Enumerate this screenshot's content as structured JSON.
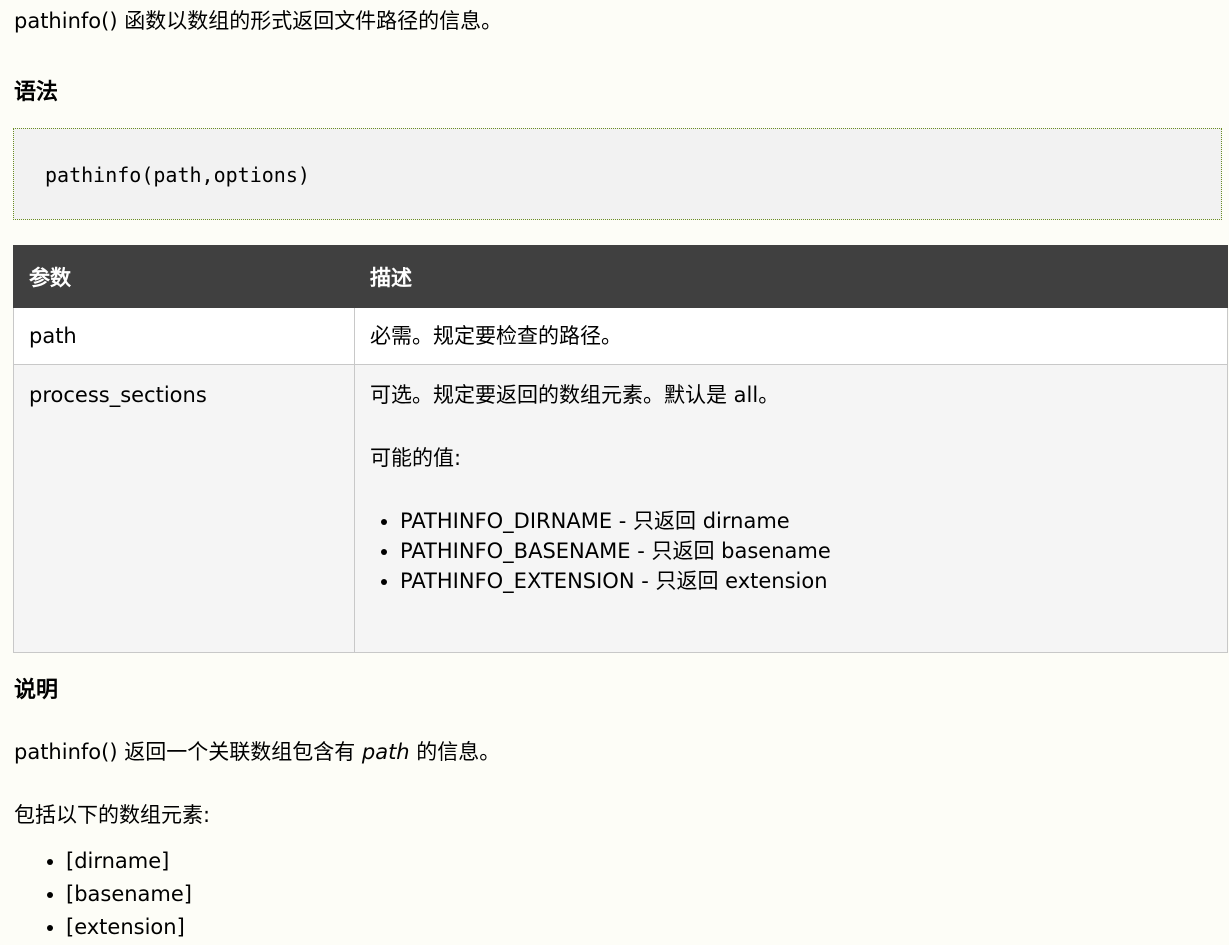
{
  "intro": "pathinfo() 函数以数组的形式返回文件路径的信息。",
  "syntax": {
    "heading": "语法",
    "code": "pathinfo(path,options)"
  },
  "params_table": {
    "headers": [
      "参数",
      "描述"
    ],
    "rows": [
      {
        "param": "path",
        "desc": "必需。规定要检查的路径。"
      },
      {
        "param": "process_sections",
        "desc": "可选。规定要返回的数组元素。默认是 all。",
        "values_label": "可能的值:",
        "values": [
          "PATHINFO_DIRNAME - 只返回 dirname",
          "PATHINFO_BASENAME - 只返回 basename",
          "PATHINFO_EXTENSION - 只返回 extension"
        ]
      }
    ]
  },
  "description": {
    "heading": "说明",
    "p1_before": "pathinfo() 返回一个关联数组包含有 ",
    "p1_em": "path",
    "p1_after": " 的信息。",
    "p2": "包括以下的数组元素:",
    "elements": [
      "[dirname]",
      "[basename]",
      "[extension]"
    ]
  }
}
